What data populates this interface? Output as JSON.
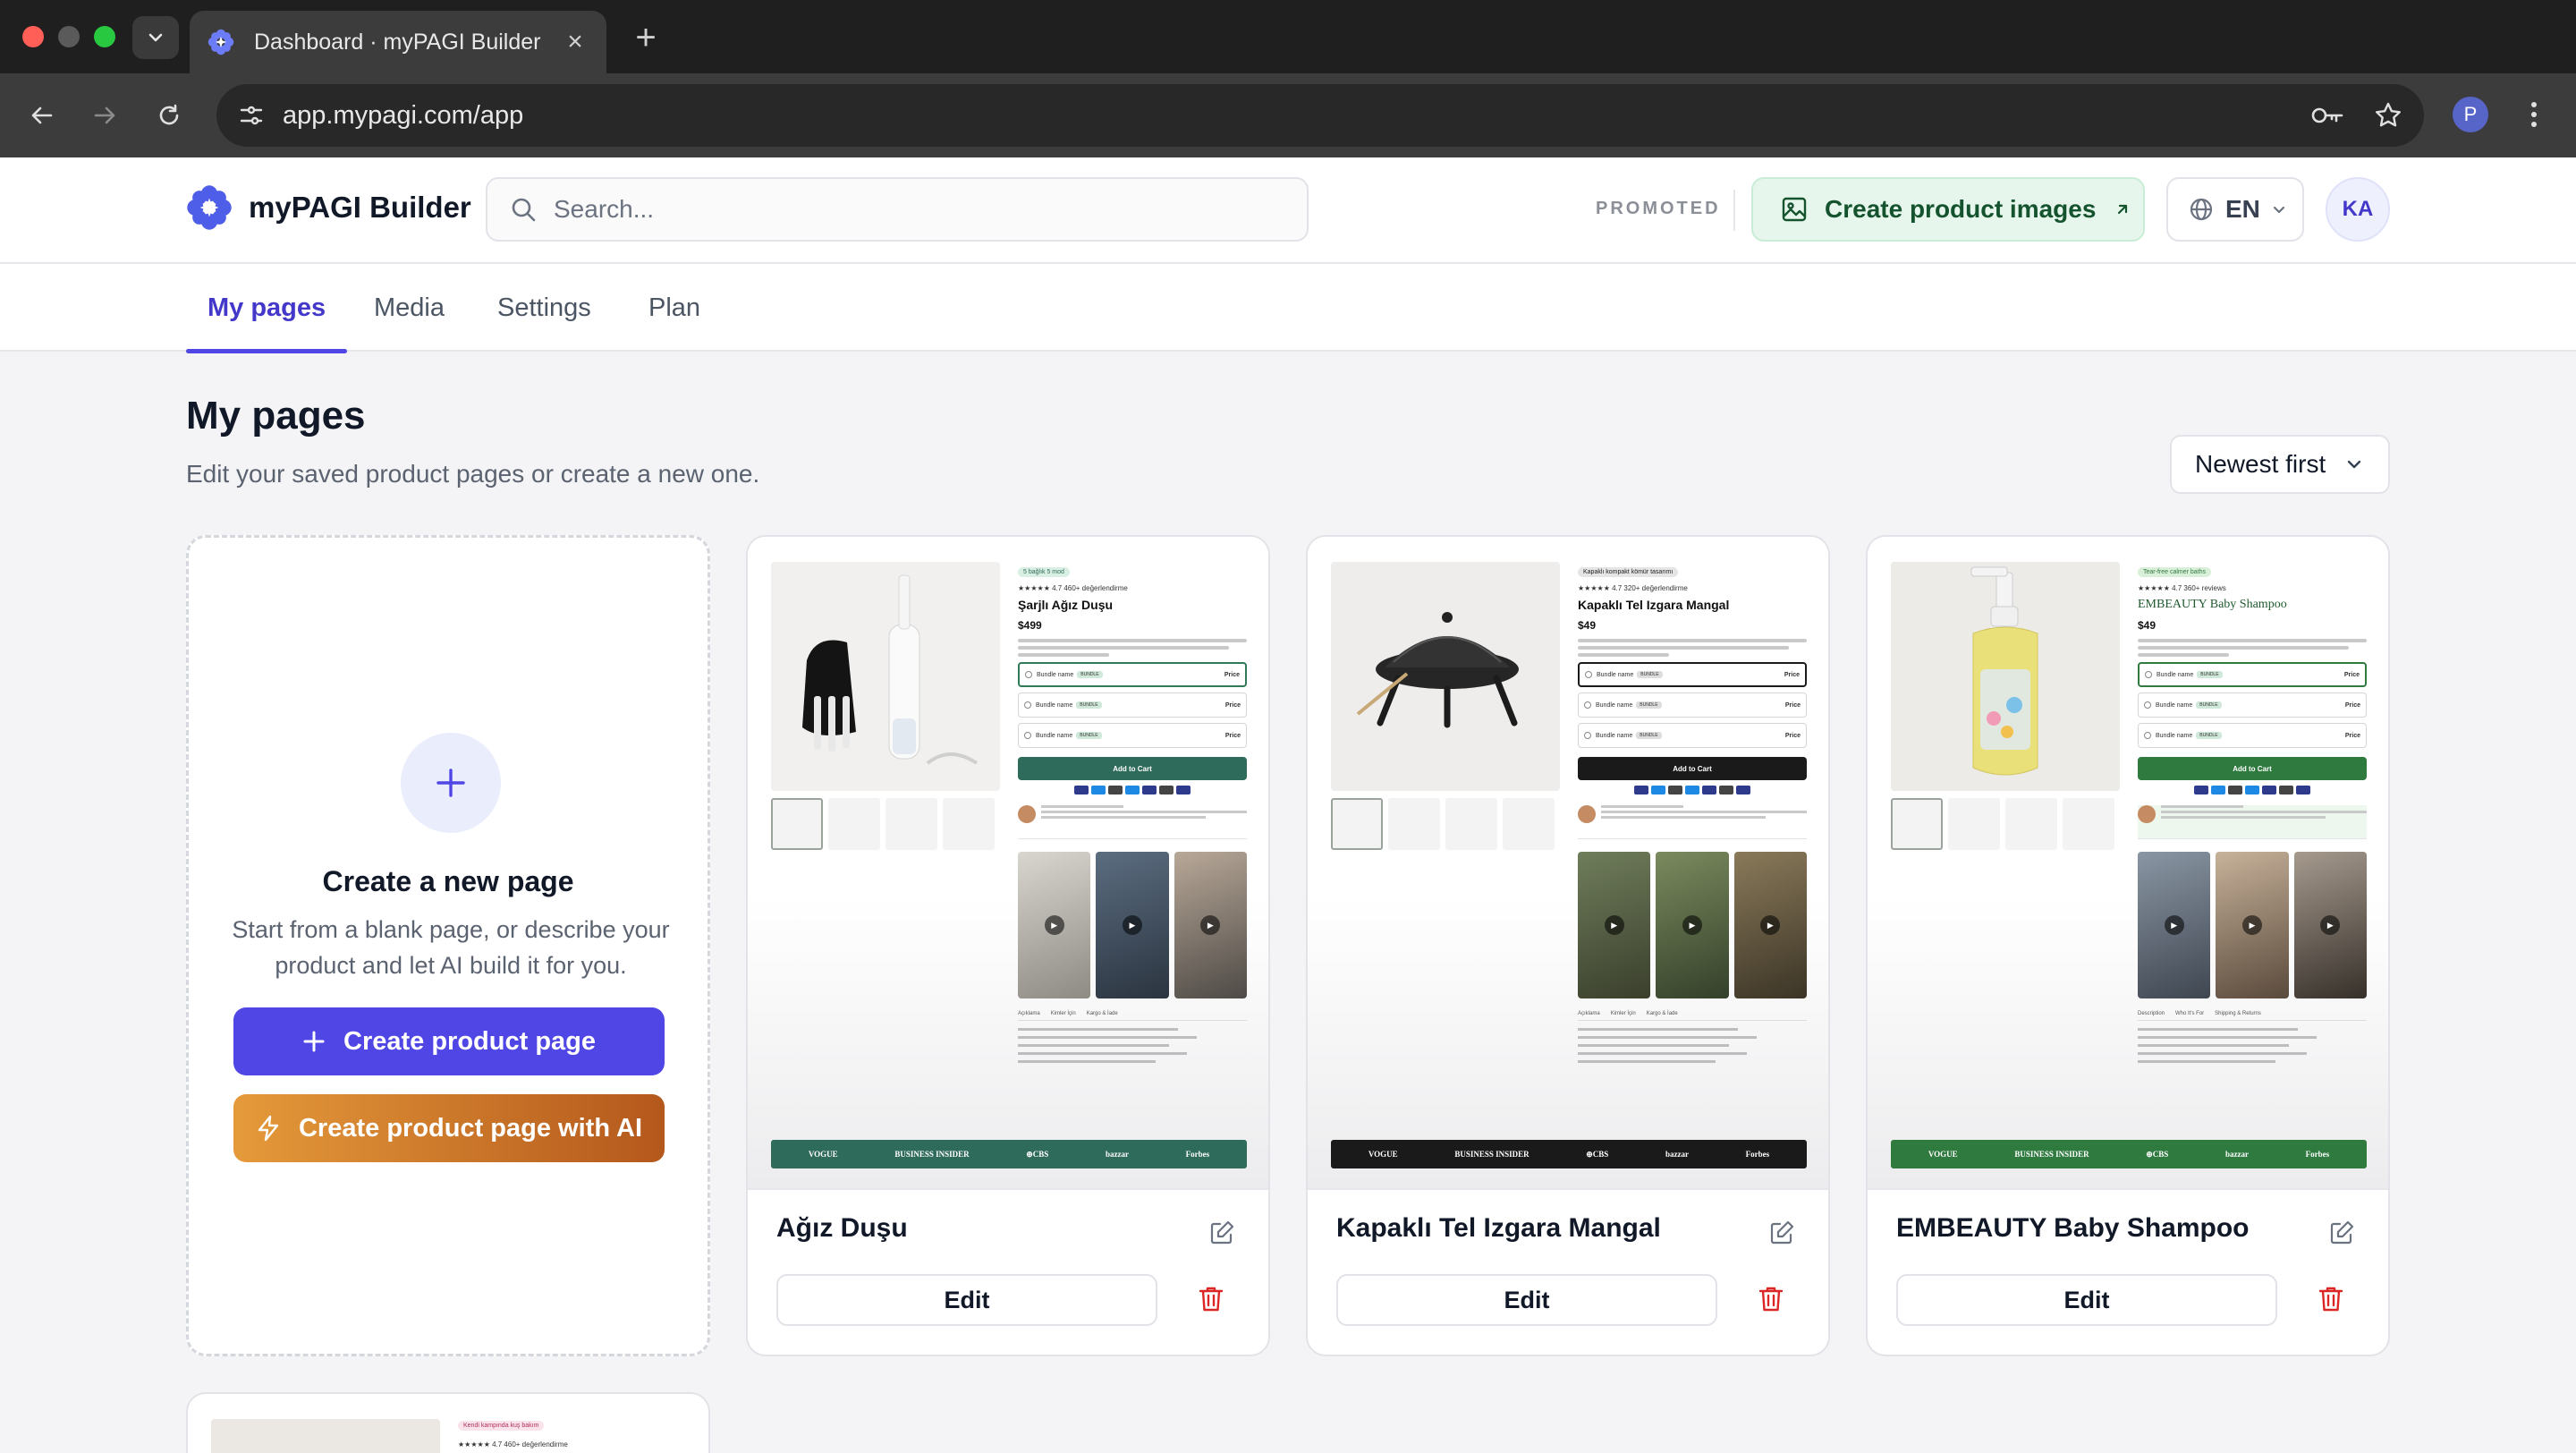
{
  "browser": {
    "tab_title": "Dashboard · myPAGI Builder",
    "tab_close": "×",
    "new_tab": "+",
    "url": "app.mypagi.com/app",
    "profile_initial": "P"
  },
  "header": {
    "brand": "myPAGI Builder",
    "search_placeholder": "Search...",
    "promoted_label": "PROMOTED",
    "promo_button": "Create product images",
    "language": "EN",
    "avatar_initials": "KA",
    "colors": {
      "accent": "#4f46e5",
      "promo_bg": "#e6f6ec"
    }
  },
  "nav": {
    "tabs": [
      {
        "label": "My pages",
        "active": true
      },
      {
        "label": "Media",
        "active": false
      },
      {
        "label": "Settings",
        "active": false
      },
      {
        "label": "Plan",
        "active": false
      }
    ]
  },
  "main": {
    "title": "My pages",
    "subtitle": "Edit your saved product pages or create a new one.",
    "sort": "Newest first"
  },
  "create_card": {
    "title": "Create a new page",
    "description": "Start from a blank page, or describe your product and let AI build it for you.",
    "primary_button": "Create product page",
    "ai_button": "Create product page with AI"
  },
  "pages": [
    {
      "title": "Ağız Duşu",
      "edit_label": "Edit",
      "preview": {
        "badge": "5 bağlık 5 mod",
        "rating": "★★★★★ 4.7 460+ değerlendirme",
        "name": "Şarjlı Ağız Duşu",
        "price": "$499",
        "accent": "#2f6b5a",
        "footer_color": "#2f6b5a",
        "cart": "Add to Cart",
        "tabs": [
          "Açıklama",
          "Kimler İçin",
          "Kargo & İade"
        ]
      }
    },
    {
      "title": "Kapaklı Tel Izgara Mangal",
      "edit_label": "Edit",
      "preview": {
        "badge": "Kapaklı kompakt kömür tasarımı",
        "rating": "★★★★★ 4.7 320+ değerlendirme",
        "name": "Kapaklı Tel Izgara Mangal",
        "price": "$49",
        "accent": "#1a1a1a",
        "footer_color": "#1a1a1a",
        "cart": "Add to Cart",
        "tabs": [
          "Açıklama",
          "Kimler İçin",
          "Kargo & İade"
        ]
      }
    },
    {
      "title": "EMBEAUTY Baby Shampoo",
      "edit_label": "Edit",
      "preview": {
        "badge": "Tear-free calmer baths",
        "rating": "★★★★★ 4.7 360+ reviews",
        "name": "EMBEAUTY Baby Shampoo",
        "price": "$49",
        "accent": "#2f7a3f",
        "footer_color": "#2f7a3f",
        "cart": "Add to Cart",
        "tabs": [
          "Description",
          "Who It's For",
          "Shipping & Returns"
        ]
      }
    }
  ],
  "partial_card": {
    "badge": "Kendi kampında kuş bakım",
    "rating": "★★★★★ 4.7 460+ değerlendirme"
  },
  "press_logos": [
    "VOGUE",
    "BUSINESS INSIDER",
    "⊕CBS",
    "bazzar",
    "Forbes"
  ]
}
